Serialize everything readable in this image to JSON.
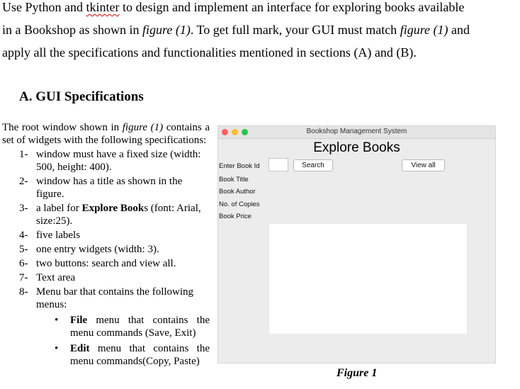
{
  "intro": {
    "line1_a": "Use Python and ",
    "line1_b": "tkinter",
    "line1_c": " to design and implement an interface for exploring books available",
    "line2_a": "in a Bookshop as shown in ",
    "line2_b": "figure (1)",
    "line2_c": ". To get full mark, your GUI must match ",
    "line2_d": "figure (1)",
    "line2_e": " and",
    "line3": "apply all the specifications and functionalities mentioned in sections (A) and (B)."
  },
  "section_title": "A. GUI Specifications",
  "desc": {
    "a": "The root window shown in ",
    "b": "figure (1)",
    "c": " contains a set of widgets with the following specifications:"
  },
  "specs": [
    {
      "num": "1-",
      "text": "window must have a fixed size (width: 500, height: 400)."
    },
    {
      "num": "2-",
      "text": "window has a title as shown in the figure."
    },
    {
      "num": "3-",
      "a": "a label for ",
      "b": "Explore Book",
      "c": "s (font: Arial, size:25)."
    },
    {
      "num": "4-",
      "text": "five labels"
    },
    {
      "num": "5-",
      "text": "one entry widgets (width: 3)."
    },
    {
      "num": "6-",
      "text": "two buttons: search and view all."
    },
    {
      "num": "7-",
      "text": "Text area"
    },
    {
      "num": "8-",
      "text": "Menu bar that contains the following menus:"
    }
  ],
  "menus": [
    {
      "bold": "File",
      "rest": " menu that contains the menu commands (Save, Exit)"
    },
    {
      "bold": "Edit",
      "rest": " menu that contains the menu commands(Copy, Paste)"
    }
  ],
  "figure": {
    "window_title": "Bookshop Management System",
    "heading": "Explore Books",
    "labels": [
      "Enter Book Id",
      "Book Title",
      "Book Author",
      "No. of Copies",
      "Book Price"
    ],
    "search_button": "Search",
    "view_all_button": "View all",
    "caption": "Figure 1"
  }
}
